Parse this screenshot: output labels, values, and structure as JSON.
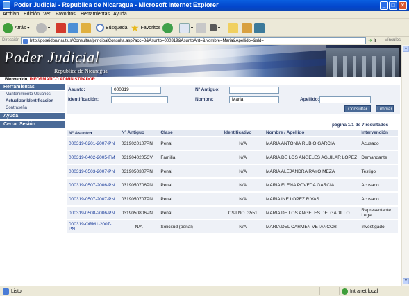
{
  "window": {
    "title": "Poder Judicial - Republica de Nicaragua - Microsoft Internet Explorer"
  },
  "menu": [
    "Archivo",
    "Edición",
    "Ver",
    "Favoritos",
    "Herramientas",
    "Ayuda"
  ],
  "toolbar": {
    "back_label": "Atrás",
    "search_label": "Búsqueda",
    "favorites_label": "Favoritos"
  },
  "address": {
    "label": "Dirección",
    "url": "http://poseidon/nautius/Consultas/principalConsulta.asp?acc=8&Asunto=000319&AsuntoAnt=&Nombre=Maria&Apellido=&sId=",
    "go_label": "Ir",
    "links_label": "Vínculos"
  },
  "banner": {
    "title": "Poder Judicial",
    "subtitle": "Republica de Nicaragua"
  },
  "welcome": {
    "prefix": "Bienvenido,",
    "user": "INFORMATICO ADMINISTRADOR"
  },
  "sidebar": {
    "sections": [
      {
        "title": "Herramientas",
        "items": [
          {
            "label": "Mantenimiento Usuarios",
            "bold": false
          },
          {
            "label": "Actualizar Identificacion",
            "bold": true
          },
          {
            "label": "Contraseña",
            "bold": false
          }
        ]
      },
      {
        "title": "Ayuda",
        "items": []
      },
      {
        "title": "Cerrar Sesión",
        "items": []
      }
    ]
  },
  "form": {
    "asunto_label": "Asunto:",
    "asunto_value": "000319",
    "antiguo_label": "Nº Antiguo:",
    "antiguo_value": "",
    "identificacion_label": "Identificación:",
    "identificacion_value": "",
    "nombre_label": "Nombre:",
    "nombre_value": "Maria",
    "apellido_label": "Apellido:",
    "apellido_value": "",
    "consultar_label": "Consultar",
    "limpiar_label": "Limpiar"
  },
  "results": {
    "page_info": "página 1/1 de 7 resultados",
    "columns": [
      "Nº Asunto",
      "Nº Antiguo",
      "Clase",
      "Identificativo",
      "Nombre / Apellido",
      "Intervención"
    ],
    "rows": [
      [
        "000319-0201-2007-PN",
        "0319020107PN",
        "Penal",
        "N/A",
        "MARIA ANTONIA RUBIO GARCIA",
        "Acusado"
      ],
      [
        "000319-0402-2005-FM",
        "0319040205CV",
        "Familia",
        "N/A",
        "MARIA DE LOS ANGELES AGUILAR LOPEZ",
        "Demandante"
      ],
      [
        "000319-0503-2007-PN",
        "0319050307PN",
        "Penal",
        "N/A",
        "MARIA ALEJANDRA RAYO MEZA",
        "Testigo"
      ],
      [
        "000319-0507-2006-PN",
        "0319050706PN",
        "Penal",
        "N/A",
        "MARIA ELENA POVEDA GARCIA",
        "Acusado"
      ],
      [
        "000319-0507-2007-PN",
        "0319050707PN",
        "Penal",
        "N/A",
        "MARIA INE LOPEZ RIVAS",
        "Acusado"
      ],
      [
        "000319-0508-2006-PN",
        "0319050806PN",
        "Penal",
        "CSJ NO. 3551",
        "MARIA DE LOS ANGELES DELGADILLO",
        "Representante Legal"
      ],
      [
        "000319-ORM1-2007-PN",
        "N/A",
        "Solicitud (penal)",
        "N/A",
        "MARIA DEL CARMEN VETANCOR",
        "Investigado"
      ]
    ]
  },
  "status": {
    "left": "Listo",
    "zone": "Intranet local"
  }
}
